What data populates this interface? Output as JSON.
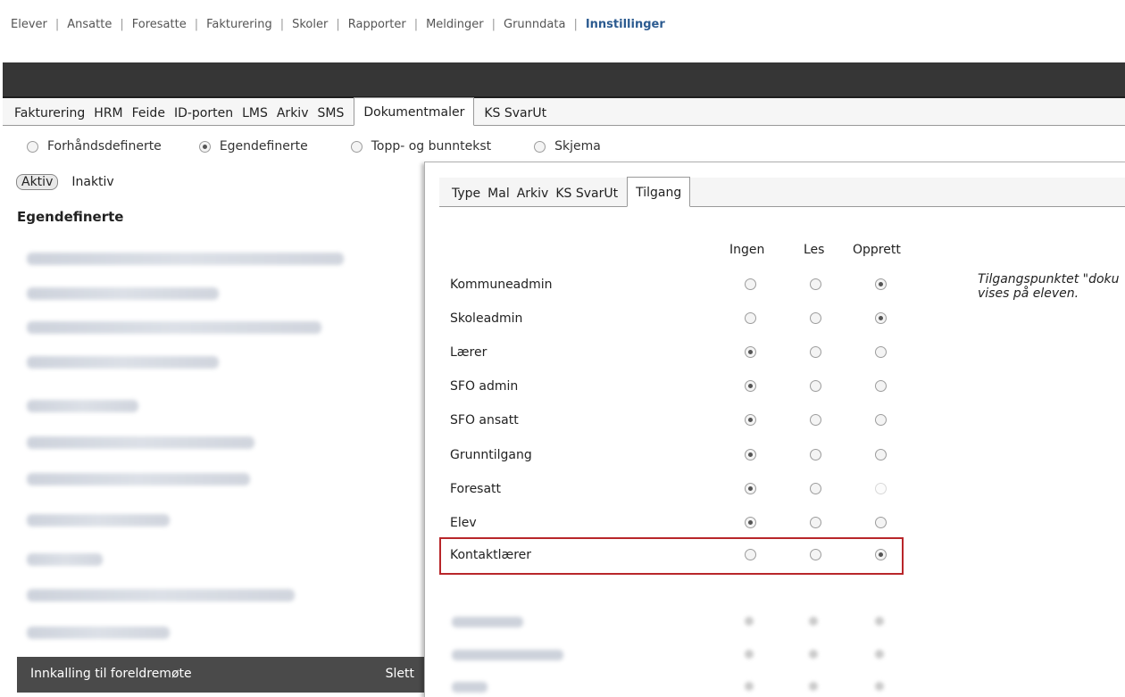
{
  "top_nav": {
    "items": [
      "Elever",
      "Ansatte",
      "Foresatte",
      "Fakturering",
      "Skoler",
      "Rapporter",
      "Meldinger",
      "Grunndata",
      "Innstillinger"
    ],
    "active": "Innstillinger"
  },
  "sub_tabs": {
    "items": [
      "Fakturering",
      "HRM",
      "Feide",
      "ID-porten",
      "LMS",
      "Arkiv",
      "SMS",
      "Dokumentmaler",
      "KS SvarUt"
    ],
    "active": "Dokumentmaler"
  },
  "template_type": {
    "options": [
      "Forhåndsdefinerte",
      "Egendefinerte",
      "Topp- og bunntekst",
      "Skjema"
    ],
    "selected": "Egendefinerte"
  },
  "status_filter": {
    "active_label": "Aktiv",
    "inactive_label": "Inaktiv"
  },
  "left_panel": {
    "title": "Egendefinerte",
    "selected_item": "Innkalling til foreldremøte",
    "delete_label": "Slett"
  },
  "panel_tabs": {
    "items": [
      "Type",
      "Mal",
      "Arkiv",
      "KS SvarUt",
      "Tilgang"
    ],
    "active": "Tilgang"
  },
  "access": {
    "columns": [
      "Ingen",
      "Les",
      "Opprett"
    ],
    "rows": [
      {
        "role": "Kommuneadmin",
        "selected": "Opprett"
      },
      {
        "role": "Skoleadmin",
        "selected": "Opprett"
      },
      {
        "role": "Lærer",
        "selected": "Ingen"
      },
      {
        "role": "SFO admin",
        "selected": "Ingen"
      },
      {
        "role": "SFO ansatt",
        "selected": "Ingen"
      },
      {
        "role": "Grunntilgang",
        "selected": "Ingen"
      },
      {
        "role": "Foresatt",
        "selected": "Ingen",
        "disabled": [
          "Opprett"
        ]
      },
      {
        "role": "Elev",
        "selected": "Ingen"
      },
      {
        "role": "Kontaktlærer",
        "selected": "Opprett",
        "highlighted": true
      }
    ],
    "note_line1": "Tilgangspunktet \"doku",
    "note_line2": "vises på eleven."
  },
  "colors": {
    "highlight_border": "#b8262a",
    "active_nav": "#2c5b90",
    "dark_bar": "#363636"
  }
}
